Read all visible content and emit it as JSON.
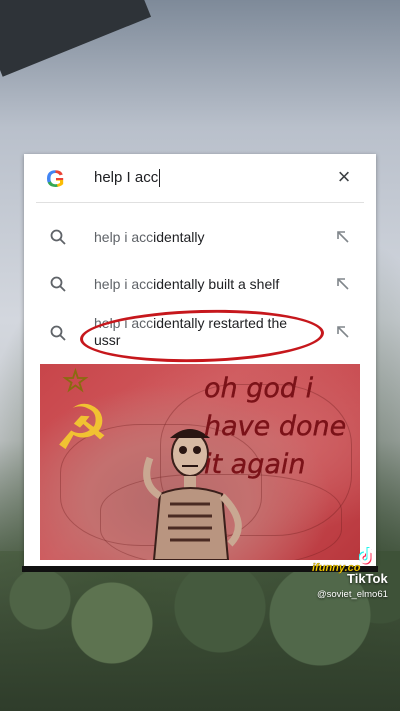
{
  "search": {
    "query": "help I acc",
    "close_icon": "×",
    "suggestions": [
      {
        "prefix": "help i acc",
        "rest": "identally"
      },
      {
        "prefix": "help i acc",
        "rest": "identally built a shelf"
      },
      {
        "prefix": "help i acc",
        "rest": "identally restarted the ussr"
      }
    ]
  },
  "meme": {
    "caption": "oh god i have done it again",
    "caption_color": "#7b1218",
    "background_color": "#c8454a"
  },
  "watermarks": {
    "ifunny": "ifunny.co",
    "tiktok": "TikTok",
    "handle": "@soviet_elmo61"
  },
  "colors": {
    "highlight_circle": "#c6171c",
    "google_blue": "#4285f4",
    "google_red": "#ea4335",
    "google_yellow": "#fbbc05",
    "google_green": "#34a853"
  }
}
